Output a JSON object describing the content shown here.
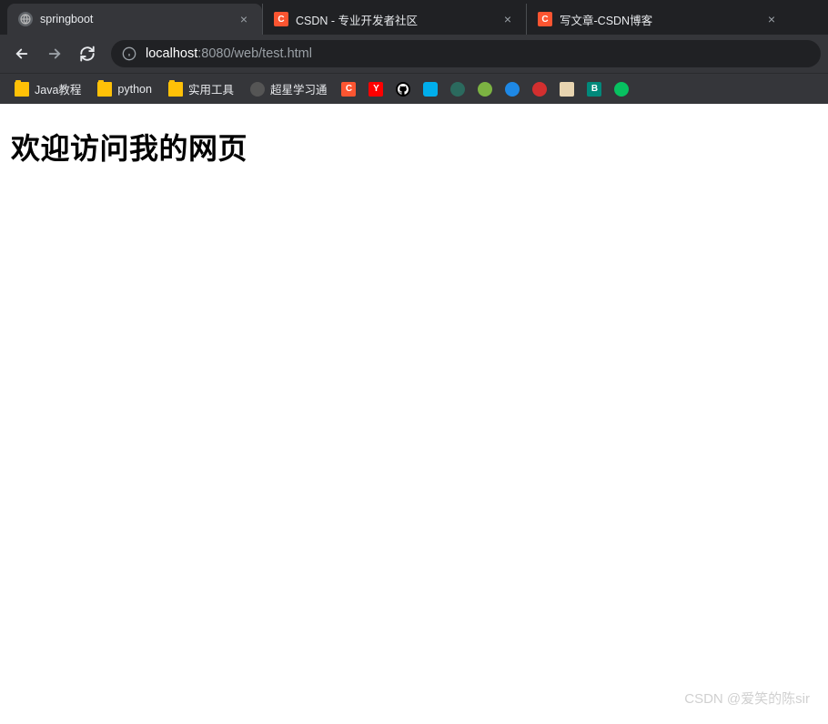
{
  "tabs": [
    {
      "title": "springboot",
      "active": true,
      "favicon_bg": "#5f6368",
      "favicon_text": ""
    },
    {
      "title": "CSDN - 专业开发者社区",
      "active": false,
      "favicon_bg": "#fc5531",
      "favicon_text": "C"
    },
    {
      "title": "写文章-CSDN博客",
      "active": false,
      "favicon_bg": "#fc5531",
      "favicon_text": "C"
    }
  ],
  "url": {
    "host": "localhost",
    "port_path": ":8080/web/test.html"
  },
  "bookmarks": {
    "text_items": [
      {
        "label": "Java教程"
      },
      {
        "label": "python"
      },
      {
        "label": "实用工具"
      },
      {
        "label": "超星学习通"
      }
    ],
    "icon_items": [
      {
        "bg": "#fc5531",
        "text": "C",
        "name": "csdn"
      },
      {
        "bg": "#ff0000",
        "text": "Y",
        "name": "y-red"
      },
      {
        "bg": "#000000",
        "text": "",
        "name": "github"
      },
      {
        "bg": "#00aeec",
        "text": "",
        "name": "bilibili"
      },
      {
        "bg": "#2b6a5e",
        "text": "",
        "name": "teal-circle"
      },
      {
        "bg": "#7cb342",
        "text": "",
        "name": "green-circle"
      },
      {
        "bg": "#1e88e5",
        "text": "",
        "name": "blue-circle"
      },
      {
        "bg": "#d32f2f",
        "text": "",
        "name": "red-circle"
      },
      {
        "bg": "#e8d4b0",
        "text": "",
        "name": "avatar"
      },
      {
        "bg": "#00897b",
        "text": "B",
        "name": "b-teal"
      },
      {
        "bg": "#07c160",
        "text": "",
        "name": "wechat"
      }
    ]
  },
  "page": {
    "heading": "欢迎访问我的网页"
  },
  "watermark": "CSDN @爱笑的陈sir"
}
